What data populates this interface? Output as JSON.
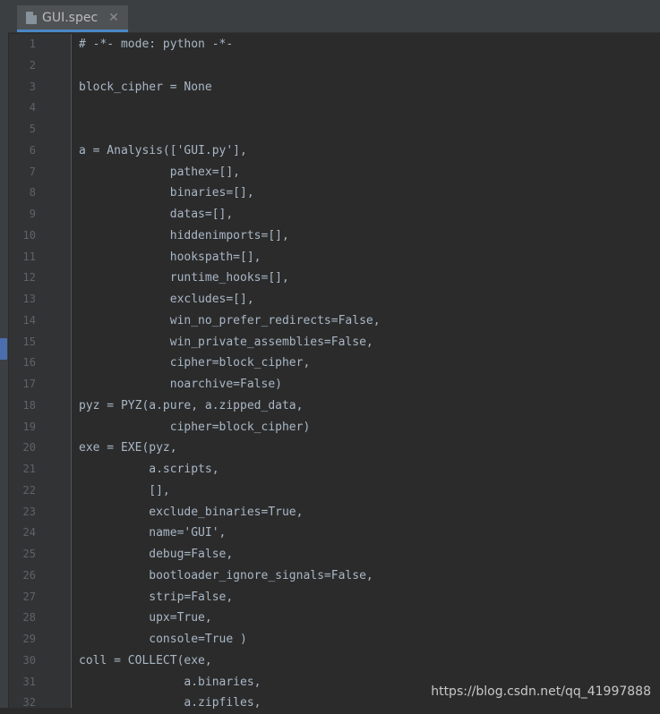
{
  "tab": {
    "title": "GUI.spec"
  },
  "gutter": {
    "line_numbers": [
      "1",
      "2",
      "3",
      "4",
      "5",
      "6",
      "7",
      "8",
      "9",
      "10",
      "11",
      "12",
      "13",
      "14",
      "15",
      "16",
      "17",
      "18",
      "19",
      "20",
      "21",
      "22",
      "23",
      "24",
      "25",
      "26",
      "27",
      "28",
      "29",
      "30",
      "31",
      "32"
    ]
  },
  "code": {
    "lines": [
      "# -*- mode: python -*-",
      "",
      "block_cipher = None",
      "",
      "",
      "a = Analysis(['GUI.py'],",
      "             pathex=[],",
      "             binaries=[],",
      "             datas=[],",
      "             hiddenimports=[],",
      "             hookspath=[],",
      "             runtime_hooks=[],",
      "             excludes=[],",
      "             win_no_prefer_redirects=False,",
      "             win_private_assemblies=False,",
      "             cipher=block_cipher,",
      "             noarchive=False)",
      "pyz = PYZ(a.pure, a.zipped_data,",
      "             cipher=block_cipher)",
      "exe = EXE(pyz,",
      "          a.scripts,",
      "          [],",
      "          exclude_binaries=True,",
      "          name='GUI',",
      "          debug=False,",
      "          bootloader_ignore_signals=False,",
      "          strip=False,",
      "          upx=True,",
      "          console=True )",
      "coll = COLLECT(exe,",
      "               a.binaries,",
      "               a.zipfiles,"
    ]
  },
  "watermark": "https://blog.csdn.net/qq_41997888"
}
